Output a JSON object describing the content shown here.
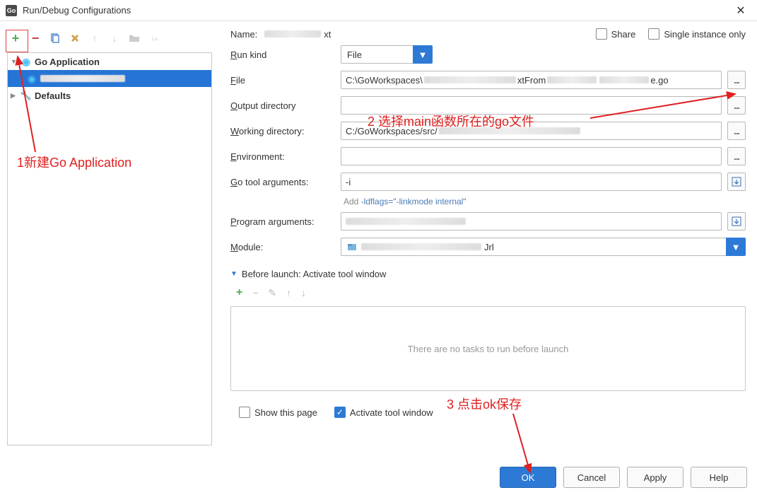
{
  "window": {
    "title": "Run/Debug Configurations"
  },
  "toolbar": {},
  "tree": {
    "root1": "Go Application",
    "child_blur": "",
    "root2": "Defaults"
  },
  "share": {
    "label": "Share"
  },
  "single": {
    "label": "Single instance only"
  },
  "labels": {
    "name": "Name:",
    "runkind": "Run kind",
    "file": "File",
    "output": "Output directory",
    "workdir": "Working directory:",
    "env": "Environment:",
    "gotool": "Go tool arguments:",
    "progargs": "Program arguments:",
    "module": "Module:"
  },
  "values": {
    "name_suffix": "xt",
    "runkind": "File",
    "file_prefix": "C:\\GoWorkspaces\\",
    "file_mid": "xtFrom",
    "file_suffix": "e.go",
    "output": "",
    "workdir_prefix": "C:/GoWorkspaces/src/",
    "env": "",
    "gotool": "-i",
    "progargs": "",
    "module_suffix": "Jrl"
  },
  "hint": {
    "pre": "Add ",
    "code": "-ldflags=\"-linkmode internal\""
  },
  "before": {
    "header": "Before launch: Activate tool window",
    "empty": "There are no tasks to run before launch"
  },
  "checks": {
    "showpage": "Show this page",
    "activate": "Activate tool window"
  },
  "buttons": {
    "ok": "OK",
    "cancel": "Cancel",
    "apply": "Apply",
    "help": "Help"
  },
  "annotations": {
    "a1": "1新建Go Application",
    "a2": "2 选择main函数所在的go文件",
    "a3": "3 点击ok保存"
  }
}
